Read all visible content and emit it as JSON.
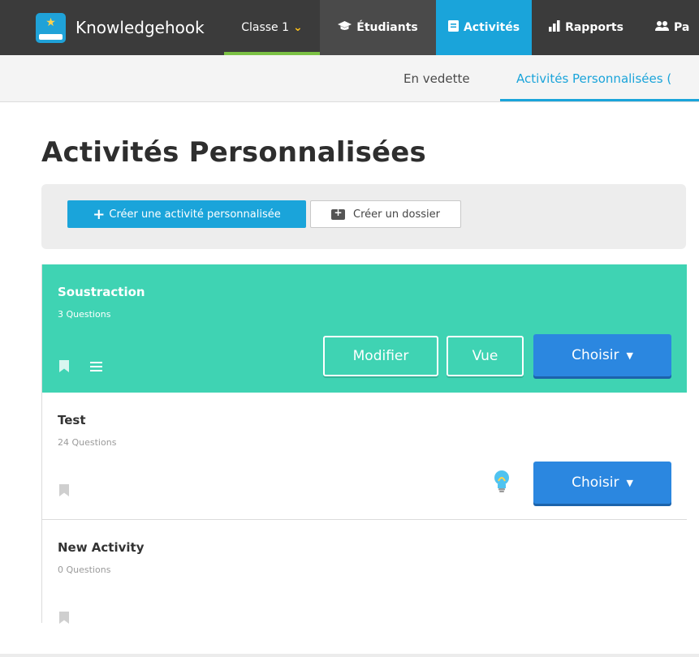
{
  "brand": {
    "name": "Knowledgehook"
  },
  "nav": {
    "class_label": "Classe 1",
    "students": "Étudiants",
    "activities": "Activités",
    "reports": "Rapports",
    "parents": "Pa"
  },
  "subnav": {
    "featured": "En vedette",
    "custom": "Activités Personnalisées ("
  },
  "page": {
    "title": "Activités Personnalisées"
  },
  "toolbar": {
    "create_activity": "Créer une activité personnalisée",
    "create_folder": "Créer un dossier"
  },
  "activities": [
    {
      "title": "Soustraction",
      "count": "3 Questions",
      "modify_label": "Modifier",
      "view_label": "Vue",
      "choose_label": "Choisir"
    },
    {
      "title": "Test",
      "count": "24 Questions",
      "choose_label": "Choisir"
    },
    {
      "title": "New Activity",
      "count": "0 Questions"
    }
  ],
  "colors": {
    "topbar": "#3b3b3b",
    "accent": "#1aa4da",
    "active_card": "#3fd3b3",
    "choose_button": "#2b87e0",
    "class_underline": "#7bc144"
  },
  "icons": [
    "logo-icon",
    "chevron-down-icon",
    "graduation-cap-icon",
    "book-icon",
    "bar-chart-icon",
    "users-icon",
    "plus-icon",
    "folder-plus-icon",
    "bookmark-icon",
    "menu-icon",
    "caret-down-icon",
    "lightbulb-icon"
  ]
}
